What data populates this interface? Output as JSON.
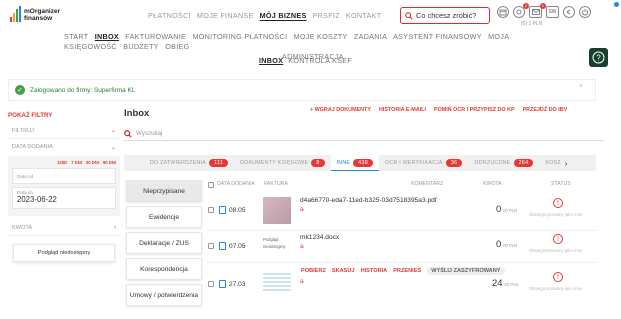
{
  "brand": {
    "name_line1": "mOrganizer",
    "name_line2": "finansów"
  },
  "topnav": [
    {
      "label": "PŁATNOŚCI",
      "active": false
    },
    {
      "label": "MOJE FINANSE",
      "active": false
    },
    {
      "label": "MÓJ BIZNES",
      "active": true
    },
    {
      "label": "PRSFIZ",
      "active": false
    },
    {
      "label": "KONTAKT",
      "active": false
    }
  ],
  "search": {
    "placeholder": "Co chcesz zrobić?"
  },
  "header_icons": {
    "bell_badge": "2",
    "msg_badge": "1",
    "sw_label": "SW",
    "balance": "(6) 1 PLN"
  },
  "subnav": [
    {
      "label": "START",
      "active": false
    },
    {
      "label": "INBOX",
      "active": true
    },
    {
      "label": "FAKTUROWANIE",
      "active": false
    },
    {
      "label": "MONITORING PŁATNOŚCI",
      "active": false
    },
    {
      "label": "MOJE KOSZTY",
      "active": false
    },
    {
      "label": "ZADANIA",
      "active": false
    },
    {
      "label": "ASYSTENT FINANSOWY",
      "active": false
    },
    {
      "label": "MOJA KSIĘGOWOŚĆ",
      "active": false
    },
    {
      "label": "BUDŻETY",
      "active": false
    },
    {
      "label": "OBIEG",
      "active": false
    },
    {
      "label": "ADMINISTRACJA",
      "active": false
    }
  ],
  "subtabs": {
    "inbox": "INBOX",
    "ksef": "KONTROLA KSEF"
  },
  "alert": {
    "text": "Zalogowano do firmy: Superfirma KL",
    "close": "×"
  },
  "filters": {
    "title": "POKAŻ FILTRY",
    "filter_label": "FILTRUJ",
    "date_label": "DATA DODANIA",
    "ranges": [
      "325D",
      "7 DNI",
      "30 DNI",
      "90 DNI"
    ],
    "date_from_label": "Data od",
    "date_to_label": "Data do",
    "date_to_value": "2023-06-22",
    "amount_label": "KWOTA",
    "preview_button": "Podgląd niedostępny"
  },
  "inbox": {
    "title": "Inbox",
    "actions": [
      "+ WGRAJ DOKUMENTY",
      "HISTORIA E-MAILI",
      "POMIŃ OCR I PRZYPISZ DO KP",
      "PRZEJDŹ DO IBV"
    ],
    "search_placeholder": "Wyszukaj"
  },
  "categories": [
    {
      "label": "DO ZATWIERDZENIA",
      "count": "111",
      "active": false
    },
    {
      "label": "DOKUMENTY KSIĘGOWE",
      "count": "8",
      "active": false
    },
    {
      "label": "INNE",
      "count": "438",
      "active": true
    },
    {
      "label": "OCR I WERYFIKACJA",
      "count": "36",
      "active": false
    },
    {
      "label": "ODRZUCONE",
      "count": "264",
      "active": false
    },
    {
      "label": "KOSZ",
      "count": "",
      "active": false
    }
  ],
  "left_categories": [
    {
      "label": "Nieprzypisane",
      "active": true
    },
    {
      "label": "Ewidencje",
      "active": false
    },
    {
      "label": "Deklaracje / ZUS",
      "active": false
    },
    {
      "label": "Korespondencja",
      "active": false
    },
    {
      "label": "Umowy / potwierdzenia",
      "active": false
    }
  ],
  "table": {
    "headers": {
      "date": "DATA DODANIA",
      "invoice": "FAKTURA",
      "comment": "KOMENTARZ",
      "amount": "KWOTA",
      "status": "STATUS"
    },
    "rows": [
      {
        "date": "08.05",
        "filename": "d4a66770-eda7-11ed-b325-03d7518395a3.pdf",
        "link": "a",
        "amount": "0",
        "currency": "00 PLN",
        "status": "Skategoryzowany jako inne"
      },
      {
        "date": "07.05",
        "preview": "Podgląd niedostępny",
        "filename": "mk1234.docx",
        "link": "a",
        "amount": "0",
        "currency": "00 PLN",
        "status": "Skategoryzowany jako inne"
      },
      {
        "date": "27.03",
        "link": "a",
        "amount": "24",
        "currency": "00 PLN",
        "status": "Skategoryzowany jako inne"
      }
    ],
    "row_actions": [
      "POBIERZ",
      "SKASUJ",
      "HISTORIA",
      "PRZENIEŚ"
    ],
    "row_action_sent": "WYŚLIJ ZASZYFROWANY"
  },
  "colors": {
    "accent": "#e53935",
    "blue": "#1e88e5",
    "dark_green": "#17412f",
    "success": "#43a047"
  },
  "icons": [
    "search-icon",
    "calendar-icon",
    "settings-icon",
    "mail-icon",
    "power-icon",
    "gear-icon",
    "check-icon",
    "chevron-down-icon",
    "chevron-right-icon",
    "document-icon"
  ]
}
